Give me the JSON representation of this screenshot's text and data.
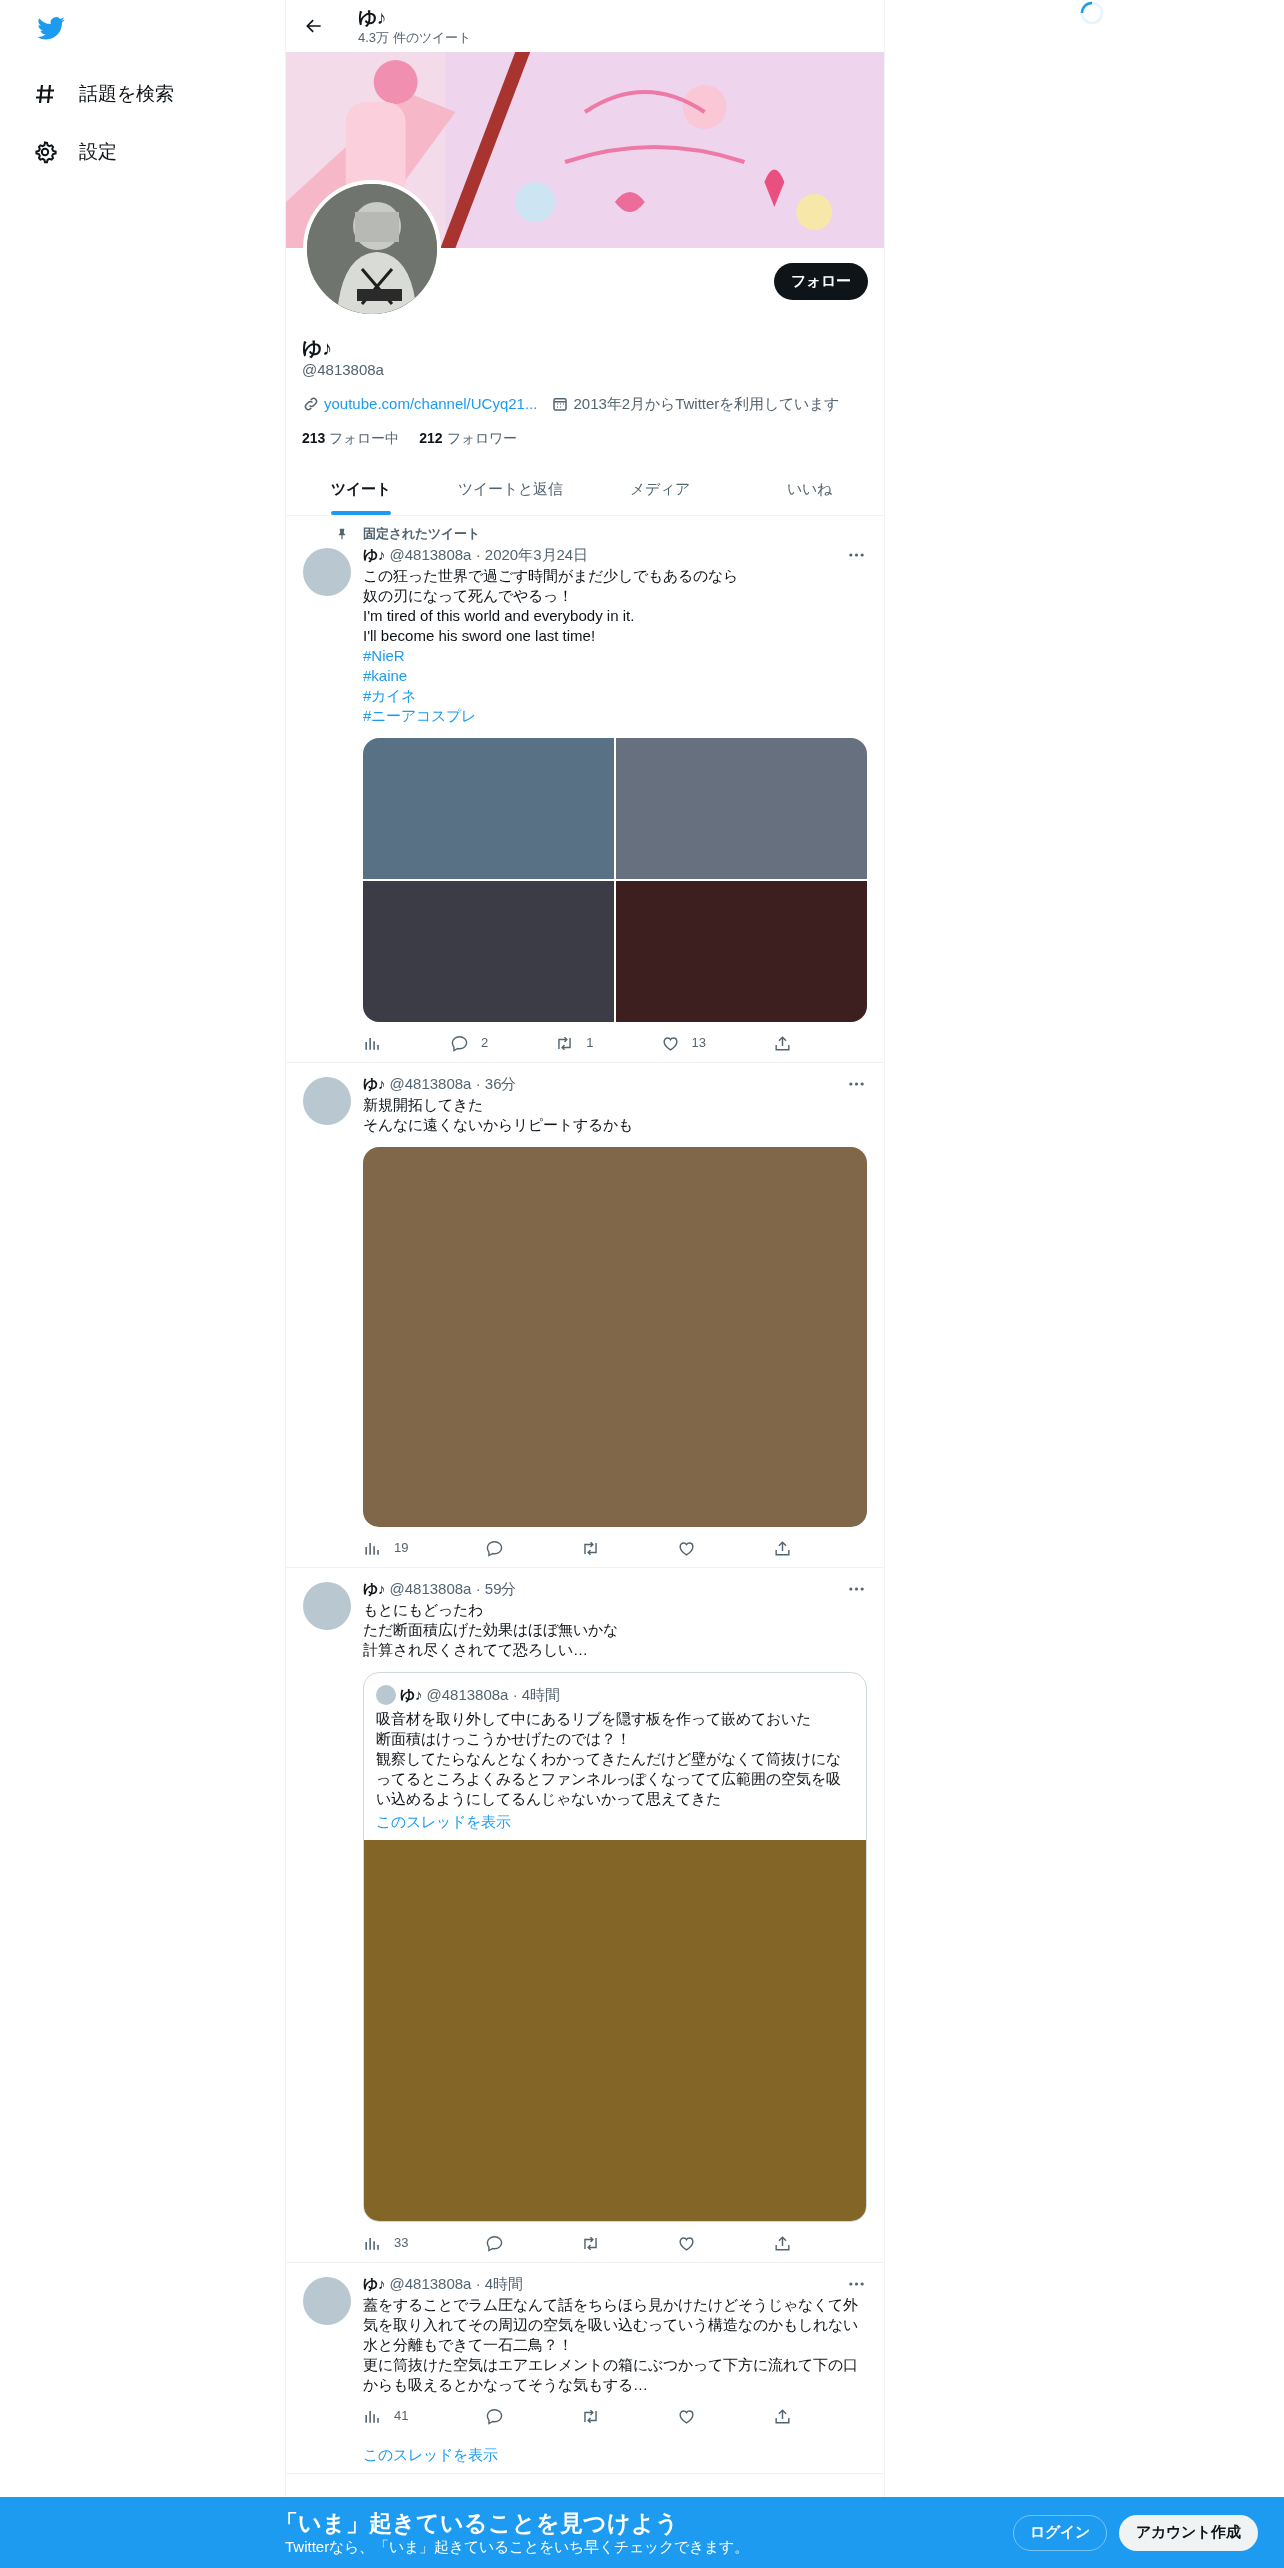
{
  "sidebar": {
    "items": [
      {
        "kind": "hash",
        "label": "話題を検索"
      },
      {
        "kind": "gear",
        "label": "設定"
      }
    ]
  },
  "header": {
    "name": "ゆ♪",
    "tweet_count": "4.3万 件のツイート"
  },
  "profile": {
    "follow_button": "フォロー",
    "name": "ゆ♪",
    "handle": "@4813808a",
    "link": "youtube.com/channel/UCyq21...",
    "joined": "2013年2月からTwitterを利用しています",
    "following_count": "213",
    "following_label": "フォロー中",
    "followers_count": "212",
    "followers_label": "フォロワー"
  },
  "tabs": [
    {
      "label": "ツイート",
      "selected": true
    },
    {
      "label": "ツイートと返信",
      "selected": false
    },
    {
      "label": "メディア",
      "selected": false
    },
    {
      "label": "いいね",
      "selected": false
    }
  ],
  "tweets": [
    {
      "pinned_label": "固定されたツイート",
      "name": "ゆ♪",
      "meta": "@4813808a · 2020年3月24日",
      "body": [
        {
          "kind": "text",
          "text": "この狂った世界で過ごす時間がまだ少しでもあるのなら"
        },
        {
          "kind": "text",
          "text": "奴の刃になって死んでやるっ！"
        },
        {
          "kind": "text",
          "text": "I'm tired of this world and everybody in it."
        },
        {
          "kind": "text",
          "text": "I'll become his sword one last time!"
        },
        {
          "kind": "hashtag",
          "text": "#NieR"
        },
        {
          "kind": "hashtag",
          "text": "#kaine"
        },
        {
          "kind": "hashtag",
          "text": "#カイネ"
        },
        {
          "kind": "hashtag",
          "text": "#ニーアコスプレ"
        }
      ],
      "media": {
        "kind": "grid",
        "tiles": [
          {
            "color": "#587184"
          },
          {
            "color": "#67707f"
          },
          {
            "color": "#3b3c45"
          },
          {
            "color": "#3e1f1f"
          }
        ]
      },
      "actions": [
        {
          "kind": "views"
        },
        {
          "kind": "reply",
          "count": "2"
        },
        {
          "kind": "retweet",
          "count": "1"
        },
        {
          "kind": "like",
          "count": "13"
        },
        {
          "kind": "share"
        }
      ]
    },
    {
      "name": "ゆ♪",
      "meta": "@4813808a · 36分",
      "body": [
        {
          "kind": "text",
          "text": "新規開拓してきた"
        },
        {
          "kind": "text",
          "text": "そんなに遠くないからリピートするかも"
        }
      ],
      "media": {
        "kind": "single",
        "tiles": [
          {
            "color": "#80674a"
          }
        ]
      },
      "actions": [
        {
          "kind": "views",
          "count": "19"
        },
        {
          "kind": "reply"
        },
        {
          "kind": "retweet"
        },
        {
          "kind": "like"
        },
        {
          "kind": "share"
        }
      ]
    },
    {
      "name": "ゆ♪",
      "meta": "@4813808a · 59分",
      "body": [
        {
          "kind": "text",
          "text": "もとにもどったわ"
        },
        {
          "kind": "text",
          "text": "ただ断面積広げた効果はほぼ無いかな"
        },
        {
          "kind": "text",
          "text": "計算され尽くされてて恐ろしい…"
        }
      ],
      "quote": {
        "name": "ゆ♪",
        "meta": "@4813808a · 4時間",
        "body": [
          "吸音材を取り外して中にあるリブを隠す板を作って嵌めておいた",
          "断面積はけっこうかせげたのでは？！",
          "観察してたらなんとなくわかってきたんだけど壁がなくて筒抜けになってるところよくみるとファンネルっぽくなってて広範囲の空気を吸い込めるようにしてるんじゃないかって思えてきた"
        ],
        "show_thread": "このスレッドを表示",
        "media": {
          "kind": "single",
          "tiles": [
            {
              "color": "#826527"
            }
          ]
        }
      },
      "actions": [
        {
          "kind": "views",
          "count": "33"
        },
        {
          "kind": "reply"
        },
        {
          "kind": "retweet"
        },
        {
          "kind": "like"
        },
        {
          "kind": "share"
        }
      ]
    },
    {
      "name": "ゆ♪",
      "meta": "@4813808a · 4時間",
      "body": [
        {
          "kind": "text",
          "text": "蓋をすることでラム圧なんて話をちらほら見かけたけどそうじゃなくて外気を取り入れてその周辺の空気を吸い込むっていう構造なのかもしれない"
        },
        {
          "kind": "text",
          "text": "水と分離もできて一石二鳥？！"
        },
        {
          "kind": "text",
          "text": "更に筒抜けた空気はエアエレメントの箱にぶつかって下方に流れて下の口からも吸えるとかなってそうな気もする…"
        }
      ],
      "actions": [
        {
          "kind": "views",
          "count": "41"
        },
        {
          "kind": "reply"
        },
        {
          "kind": "retweet"
        },
        {
          "kind": "like"
        },
        {
          "kind": "share"
        }
      ],
      "show_thread": "このスレッドを表示"
    }
  ],
  "signup_bar": {
    "title": "「いま」起きていることを見つけよう",
    "subtitle": "Twitterなら、「いま」起きていることをいち早くチェックできます。",
    "login_button": "ログイン",
    "signup_button": "アカウント作成"
  }
}
